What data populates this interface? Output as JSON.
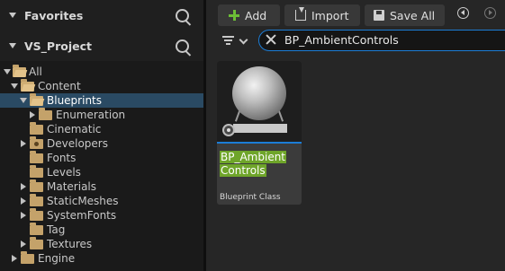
{
  "sidebar": {
    "favorites_title": "Favorites",
    "project_title": "VS_Project",
    "tree": [
      {
        "label": "All"
      },
      {
        "label": "Content"
      },
      {
        "label": "Blueprints"
      },
      {
        "label": "Enumeration"
      },
      {
        "label": "Cinematic"
      },
      {
        "label": "Developers"
      },
      {
        "label": "Fonts"
      },
      {
        "label": "Levels"
      },
      {
        "label": "Materials"
      },
      {
        "label": "StaticMeshes"
      },
      {
        "label": "SystemFonts"
      },
      {
        "label": "Tag"
      },
      {
        "label": "Textures"
      },
      {
        "label": "Engine"
      }
    ]
  },
  "toolbar": {
    "add_label": "Add",
    "import_label": "Import",
    "save_all_label": "Save All"
  },
  "search": {
    "value": "BP_AmbientControls"
  },
  "assets": [
    {
      "name_line1": "BP_Ambient",
      "name_line2": "Controls",
      "type": "Blueprint Class"
    }
  ],
  "colors": {
    "accent": "#1c7dd6",
    "add_green": "#6cbe36",
    "highlight": "#6fa52a",
    "selection": "#2a4a63"
  }
}
